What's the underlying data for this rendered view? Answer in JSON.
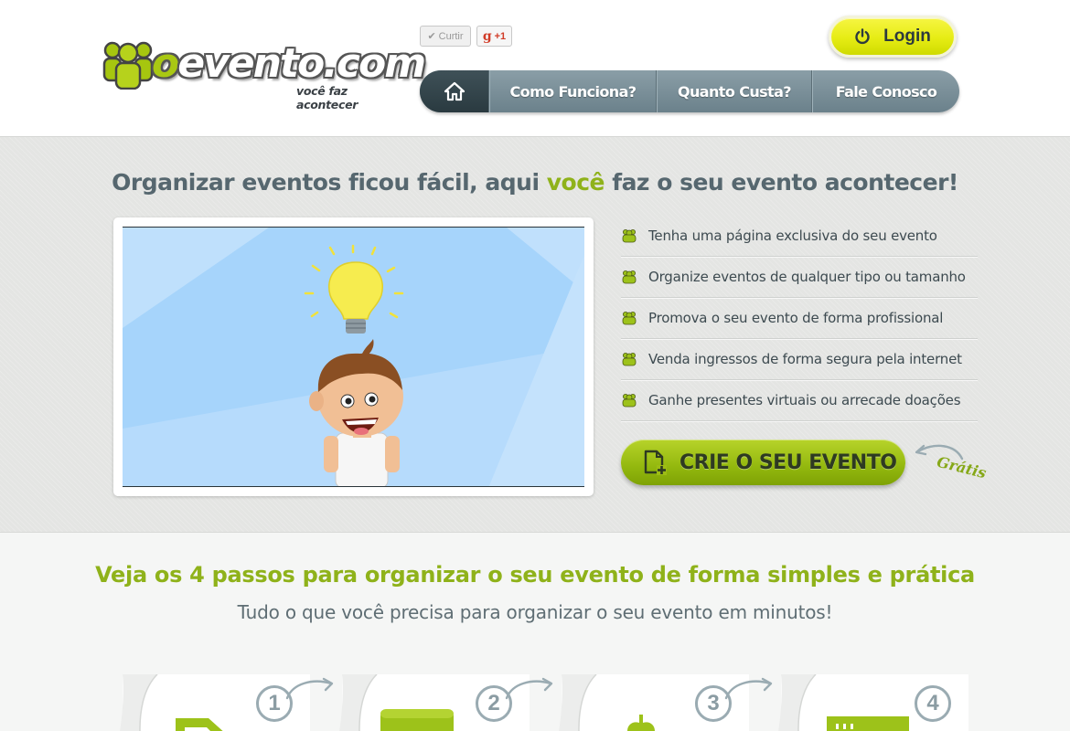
{
  "header": {
    "logo": {
      "brand_o": "o",
      "brand_rest": "evento.com",
      "tagline": "você faz acontecer"
    },
    "social": {
      "like_label": "Curtir",
      "gplus_g": "g",
      "gplus_label": "+1"
    },
    "login_label": "Login",
    "nav": [
      {
        "label": "home",
        "icon": "home-icon"
      },
      {
        "label": "Como Funciona?"
      },
      {
        "label": "Quanto Custa?"
      },
      {
        "label": "Fale Conosco"
      }
    ]
  },
  "hero": {
    "title_before": "Organizar eventos ficou fácil, aqui ",
    "title_highlight": "você",
    "title_after": " faz o seu evento acontecer!",
    "features": [
      "Tenha uma página exclusiva do seu evento",
      "Organize eventos de qualquer tipo ou tamanho",
      "Promova o seu evento de forma profissional",
      "Venda ingressos de forma segura pela internet",
      "Ganhe presentes virtuais ou arrecade doações"
    ],
    "cta_label": "CRIE O SEU EVENTO",
    "cta_note": "Grátis"
  },
  "steps": {
    "title": "Veja os 4 passos para organizar o seu evento de forma simples e prática",
    "subtitle": "Tudo o que você precisa para organizar o seu evento em minutos!",
    "items": [
      "1",
      "2",
      "3",
      "4"
    ]
  },
  "colors": {
    "accent_green": "#8fb21a",
    "nav_gray": "#7a8f98",
    "login_yellow": "#e6ec14",
    "text_dark": "#3d4a50"
  }
}
